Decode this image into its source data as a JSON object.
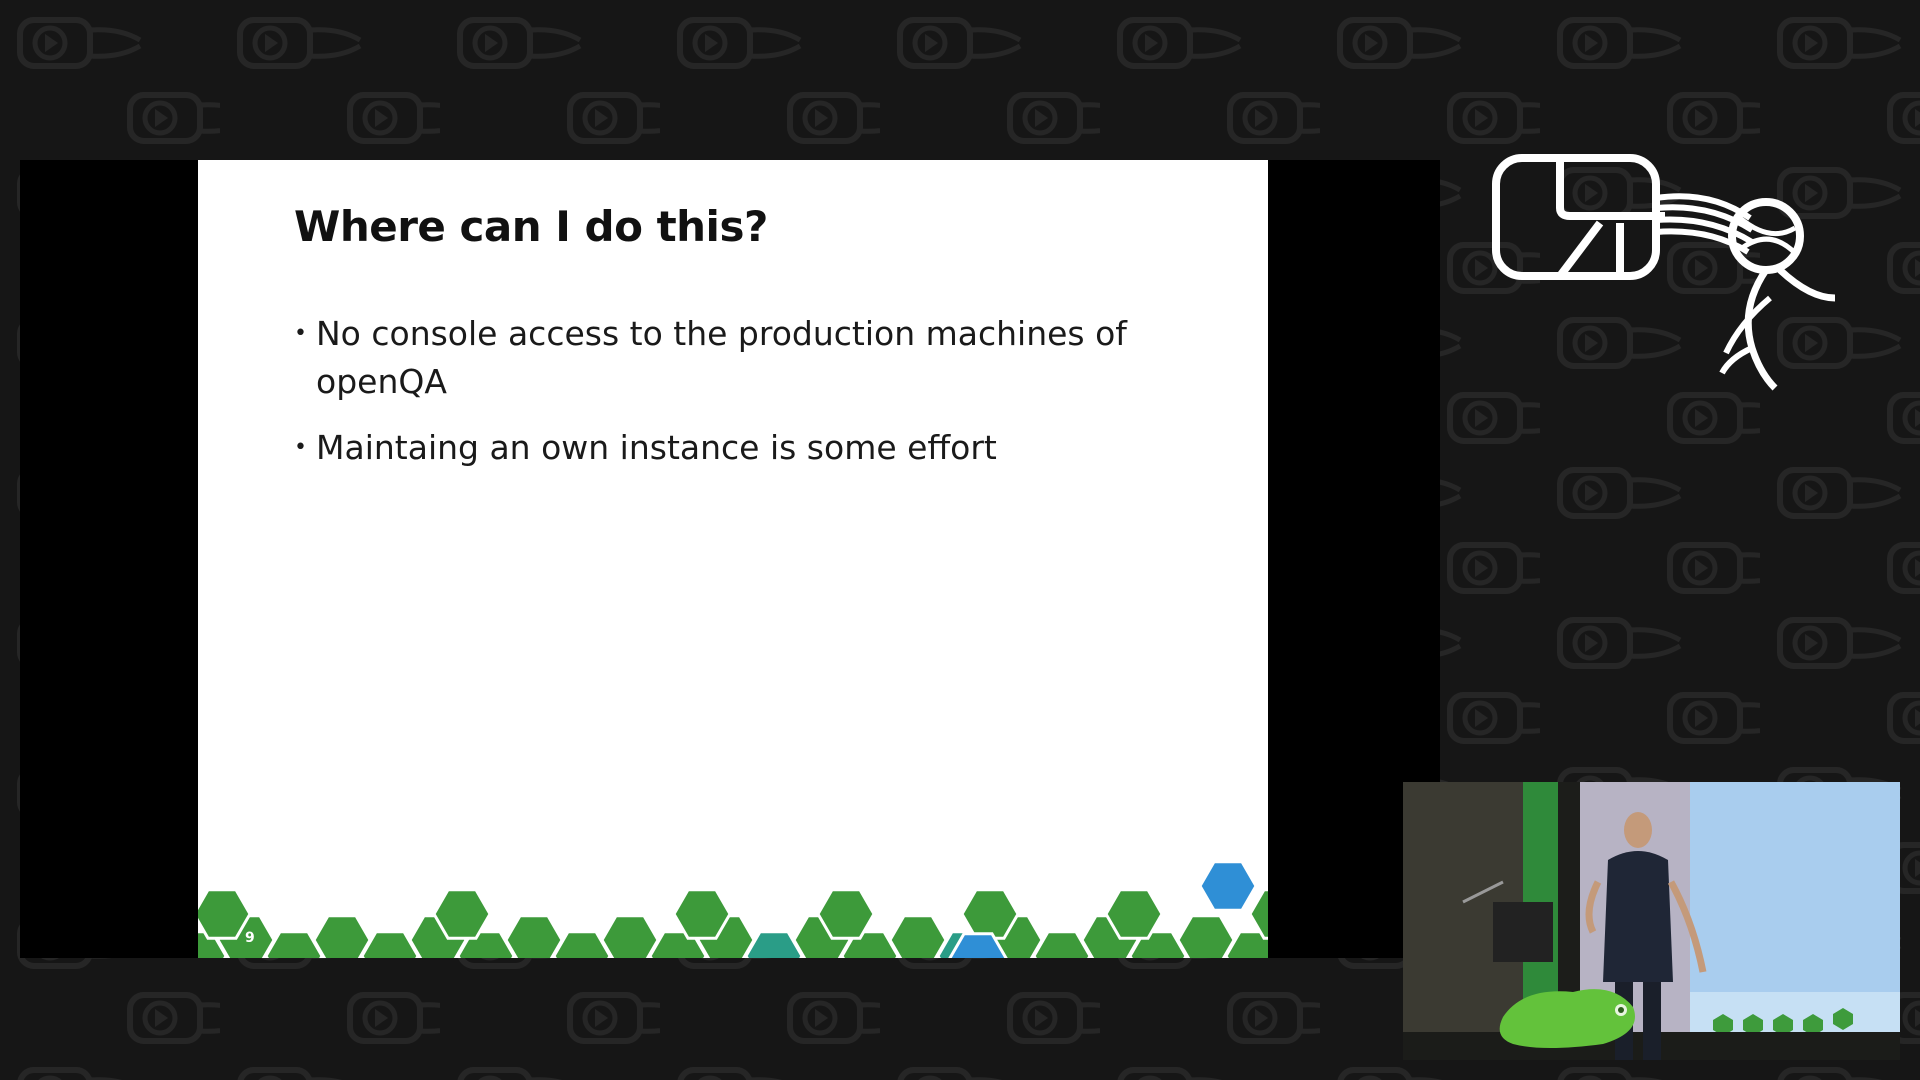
{
  "slide": {
    "title": "Where can I do this?",
    "bullets": [
      "No console access to the production machines of openQA",
      "Maintaing an own instance is some effort"
    ],
    "page_number": "9"
  },
  "colors": {
    "background": "#161616",
    "hex_green": "#3d9a3a",
    "hex_teal": "#2a9d87",
    "hex_blue": "#2f8fd6",
    "logo": "#ffffff"
  },
  "icons": {
    "conference_logo": "play-with-tentacles-logo",
    "slide_logo": "chameleon-hex-logo"
  }
}
